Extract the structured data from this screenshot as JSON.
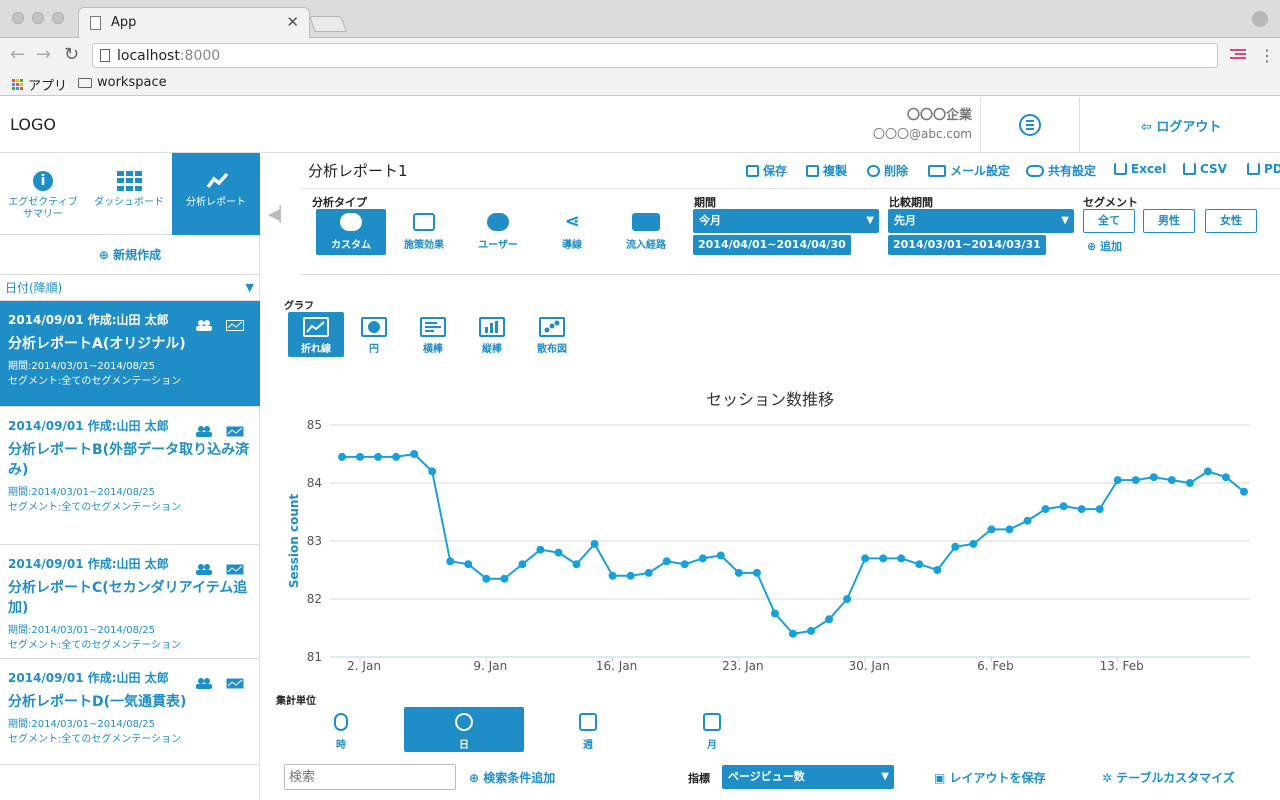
{
  "browser": {
    "tab_title": "App",
    "url_host": "localhost",
    "url_port": ":8000",
    "bookmarks": [
      "アプリ",
      "workspace"
    ]
  },
  "header": {
    "logo": "LOGO",
    "company": "〇〇〇企業",
    "email": "〇〇〇@abc.com",
    "logout": "ログアウト"
  },
  "sidebar": {
    "tabs": [
      {
        "label_line1": "エグゼクティブ",
        "label_line2": "サマリー",
        "icon": "info-icon"
      },
      {
        "label_line1": "ダッシュボード",
        "label_line2": "",
        "icon": "grid-icon"
      },
      {
        "label_line1": "分析レポート",
        "label_line2": "",
        "icon": "trend-icon"
      }
    ],
    "new_report": "新規作成",
    "sort_label": "日付(降順)",
    "reports": [
      {
        "date": "2014/09/01 作成:山田 太郎",
        "title": "分析レポートA(オリジナル)",
        "period": "期間:2014/03/01~2014/08/25",
        "segment": "セグメント:全てのセグメンテーション"
      },
      {
        "date": "2014/09/01 作成:山田 太郎",
        "title": "分析レポートB(外部データ取り込み済み)",
        "period": "期間:2014/03/01~2014/08/25",
        "segment": "セグメント:全てのセグメンテーション"
      },
      {
        "date": "2014/09/01 作成:山田 太郎",
        "title": "分析レポートC(セカンダリアイテム追加)",
        "period": "期間:2014/03/01~2014/08/25",
        "segment": "セグメント:全てのセグメンテーション"
      },
      {
        "date": "2014/09/01 作成:山田 太郎",
        "title": "分析レポートD(一気通貫表)",
        "period": "期間:2014/03/01~2014/08/25",
        "segment": "セグメント:全てのセグメンテーション"
      }
    ]
  },
  "toolbar": {
    "report_title": "分析レポート1",
    "actions": [
      "保存",
      "複製",
      "削除",
      "メール設定",
      "共有設定",
      "Excel",
      "CSV",
      "PDF"
    ]
  },
  "options": {
    "analysis_type_label": "分析タイプ",
    "analysis_types": [
      "カスタム",
      "施策効果",
      "ユーザー",
      "導線",
      "流入経路"
    ],
    "period_label": "期間",
    "period_value": "今月",
    "period_range": "2014/04/01~2014/04/30",
    "compare_label": "比較期間",
    "compare_value": "先月",
    "compare_range": "2014/03/01~2014/03/31",
    "segment_label": "セグメント",
    "segments": [
      "全て",
      "男性",
      "女性"
    ],
    "segment_add": "追加"
  },
  "graph": {
    "label": "グラフ",
    "types": [
      "折れ線",
      "円",
      "横棒",
      "縦棒",
      "散布図"
    ]
  },
  "chart_data": {
    "type": "line",
    "title": "セッション数推移",
    "xlabel": "",
    "ylabel": "Session count",
    "ylim": [
      81,
      85
    ],
    "yticks": [
      81,
      82,
      83,
      84,
      85
    ],
    "x_start": "1. Jan",
    "x_tick_labels": [
      "2. Jan",
      "9. Jan",
      "16. Jan",
      "23. Jan",
      "30. Jan",
      "6. Feb",
      "13. Feb"
    ],
    "x_tick_days": [
      1,
      8,
      15,
      22,
      29,
      36,
      43
    ],
    "grid": true,
    "color": "#1aa0d8",
    "values": [
      84.45,
      84.45,
      84.45,
      84.45,
      84.5,
      84.2,
      82.65,
      82.6,
      82.35,
      82.35,
      82.6,
      82.85,
      82.8,
      82.6,
      82.95,
      82.4,
      82.4,
      82.45,
      82.65,
      82.6,
      82.7,
      82.75,
      82.45,
      82.45,
      81.75,
      81.4,
      81.45,
      81.65,
      82.0,
      82.7,
      82.7,
      82.7,
      82.6,
      82.5,
      82.9,
      82.95,
      83.2,
      83.2,
      83.35,
      83.55,
      83.6,
      83.55,
      83.55,
      84.05,
      84.05,
      84.1,
      84.05,
      84.0,
      84.2,
      84.1,
      83.85
    ]
  },
  "aggregation": {
    "label": "集計単位",
    "units": [
      "時",
      "日",
      "週",
      "月"
    ]
  },
  "bottom": {
    "search_placeholder": "検索",
    "add_condition": "検索条件追加",
    "metric_label": "指標",
    "metric_value": "ページビュー数",
    "save_layout": "レイアウトを保存",
    "table_customize": "テーブルカスタマイズ"
  }
}
